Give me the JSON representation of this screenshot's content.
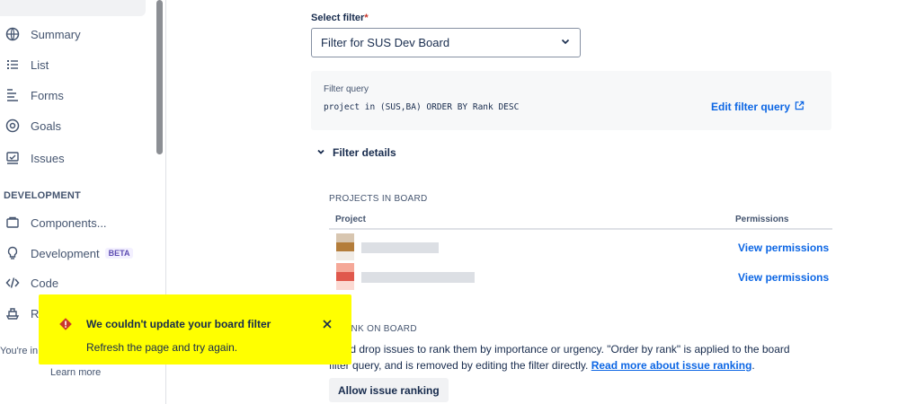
{
  "sidebar": {
    "items": [
      {
        "label": "Summary",
        "icon": "globe-icon"
      },
      {
        "label": "List",
        "icon": "list-icon"
      },
      {
        "label": "Forms",
        "icon": "forms-icon"
      },
      {
        "label": "Goals",
        "icon": "goals-icon"
      },
      {
        "label": "Issues",
        "icon": "issues-icon"
      }
    ],
    "section_label": "DEVELOPMENT",
    "dev_items": [
      {
        "label": "Components...",
        "icon": "components-icon"
      },
      {
        "label": "Development",
        "icon": "lightbulb-icon",
        "badge": "BETA"
      },
      {
        "label": "Code",
        "icon": "code-icon"
      },
      {
        "label": "Rel",
        "icon": "releases-icon"
      }
    ],
    "bottom_text": "You're in a c",
    "learn_more": "Learn more"
  },
  "filter": {
    "label": "Select filter",
    "required_mark": "*",
    "selected_value": "Filter for SUS Dev Board",
    "query_label": "Filter query",
    "query": "project in (SUS,BA) ORDER BY Rank DESC",
    "edit_link": "Edit filter query",
    "details_toggle": "Filter details"
  },
  "projects": {
    "heading": "PROJECTS IN BOARD",
    "col_project": "Project",
    "col_permissions": "Permissions",
    "rows": [
      {
        "permissions_link": "View permissions",
        "avatar_top": "#d8c6b0",
        "avatar_bottom": "#b47d3a"
      },
      {
        "permissions_link": "View permissions",
        "avatar_top": "#f5a898",
        "avatar_bottom": "#e0584c"
      }
    ]
  },
  "rank": {
    "heading": "E RANK ON BOARD",
    "text_line1": "g and drop issues to rank them by importance or urgency. \"Order by rank\" is applied to the board",
    "text_line2_prefix": "filter query, and is removed by editing the filter directly.",
    "link": "Read more about issue ranking",
    "text_suffix": ".",
    "button": "Allow issue ranking"
  },
  "toast": {
    "title": "We couldn't update your board filter",
    "body": "Refresh the page and try again.",
    "highlight_color": "#ffff00",
    "icon_color": "#c9372c"
  }
}
